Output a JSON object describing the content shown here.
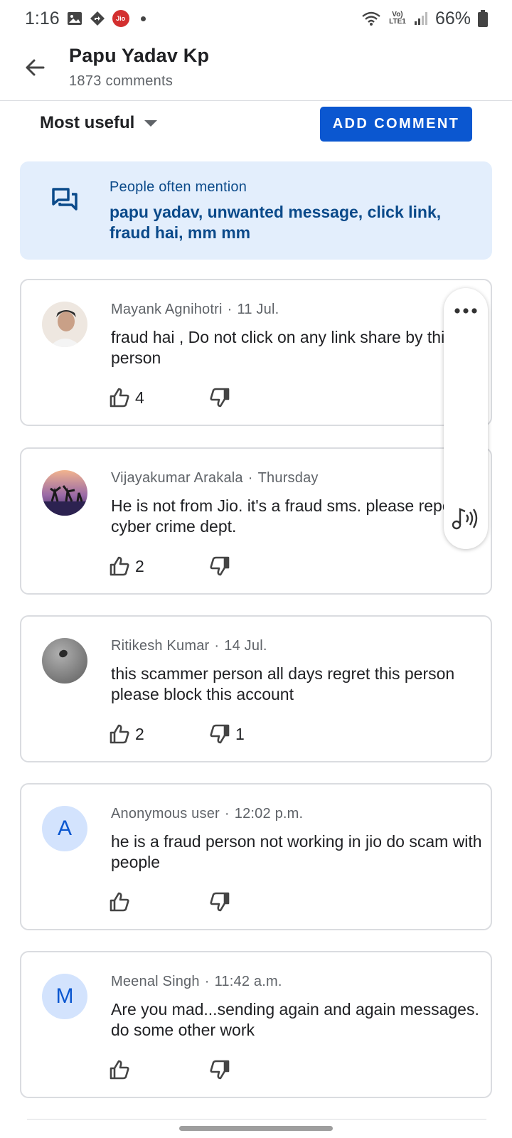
{
  "status_bar": {
    "time": "1:16",
    "carrier_badge": "Jio",
    "network_label": "Vo) LTE1",
    "battery": "66%",
    "icons": [
      "gallery-icon",
      "nav-arrow-icon",
      "jio-icon",
      "wifi-icon",
      "signal-icon",
      "battery-icon"
    ]
  },
  "header": {
    "title": "Papu Yadav Kp",
    "subtitle": "1873 comments"
  },
  "sort": {
    "label": "Most useful"
  },
  "add_comment_label": "ADD COMMENT",
  "mentions": {
    "heading": "People often mention",
    "keywords": "papu yadav, unwanted message, click link, fraud hai, mm mm"
  },
  "comments": [
    {
      "author": "Mayank Agnihotri",
      "date": "11 Jul.",
      "text": "fraud hai , Do not click on any link share by this person",
      "likes": "4",
      "dislikes": ""
    },
    {
      "author": "Vijayakumar Arakala",
      "date": "Thursday",
      "text": "He is not from Jio. it's a fraud sms. please report to cyber crime dept.",
      "likes": "2",
      "dislikes": ""
    },
    {
      "author": "Ritikesh Kumar",
      "date": "14 Jul.",
      "text": "this scammer person all days regret this person please block this account",
      "likes": "2",
      "dislikes": "1"
    },
    {
      "author": "Anonymous user",
      "avatar_letter": "A",
      "date": "12:02 p.m.",
      "text": "he is a fraud person not working in jio do scam with people",
      "likes": "",
      "dislikes": ""
    },
    {
      "author": "Meenal Singh",
      "avatar_letter": "M",
      "date": "11:42 a.m.",
      "text": "Are you mad...sending again and again messages. do some other work",
      "likes": "",
      "dislikes": ""
    }
  ],
  "colors": {
    "accent": "#0b57d0",
    "mentions_bg": "#e3eefc",
    "mentions_text": "#0b4a8a",
    "avatar_letter_bg": "#d3e3fd"
  }
}
